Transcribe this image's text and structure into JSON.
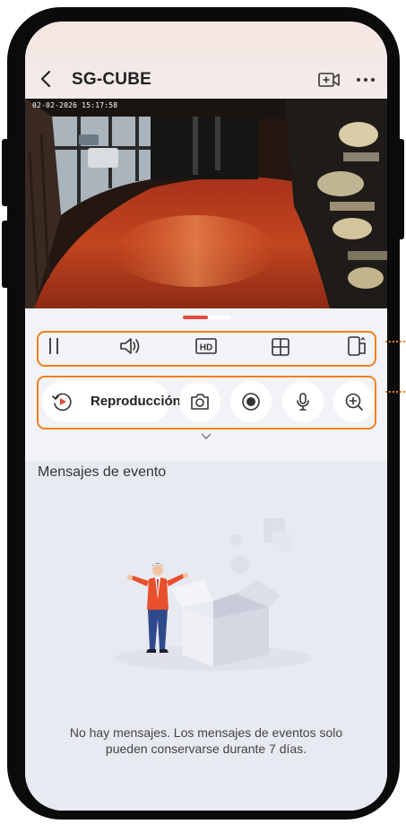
{
  "header": {
    "title": "SG-CUBE",
    "back_icon": "chevron-left-icon",
    "camera_add_icon": "video-add-icon",
    "more_icon": "more-dots-icon"
  },
  "video": {
    "timestamp": "02-02-2026 15:17:58"
  },
  "controls_row1": [
    {
      "name": "pause",
      "icon": "pause-icon"
    },
    {
      "name": "sound",
      "icon": "speaker-icon"
    },
    {
      "name": "hd",
      "icon": "hd-icon",
      "label": "HD"
    },
    {
      "name": "multiview",
      "icon": "grid-icon"
    },
    {
      "name": "fullscreen",
      "icon": "rotate-screen-icon"
    }
  ],
  "controls_row2": {
    "playback_label": "Reproducción",
    "buttons": [
      "camera-snapshot-icon",
      "record-icon",
      "microphone-icon",
      "zoom-in-icon"
    ]
  },
  "events": {
    "title": "Mensajes de evento",
    "empty_message": "No hay mensajes. Los mensajes de eventos solo pueden conservarse durante 7 días."
  },
  "colors": {
    "highlight": "#f0801a",
    "active_page": "#e84b3c",
    "panel_bg": "#f2f3f7"
  }
}
